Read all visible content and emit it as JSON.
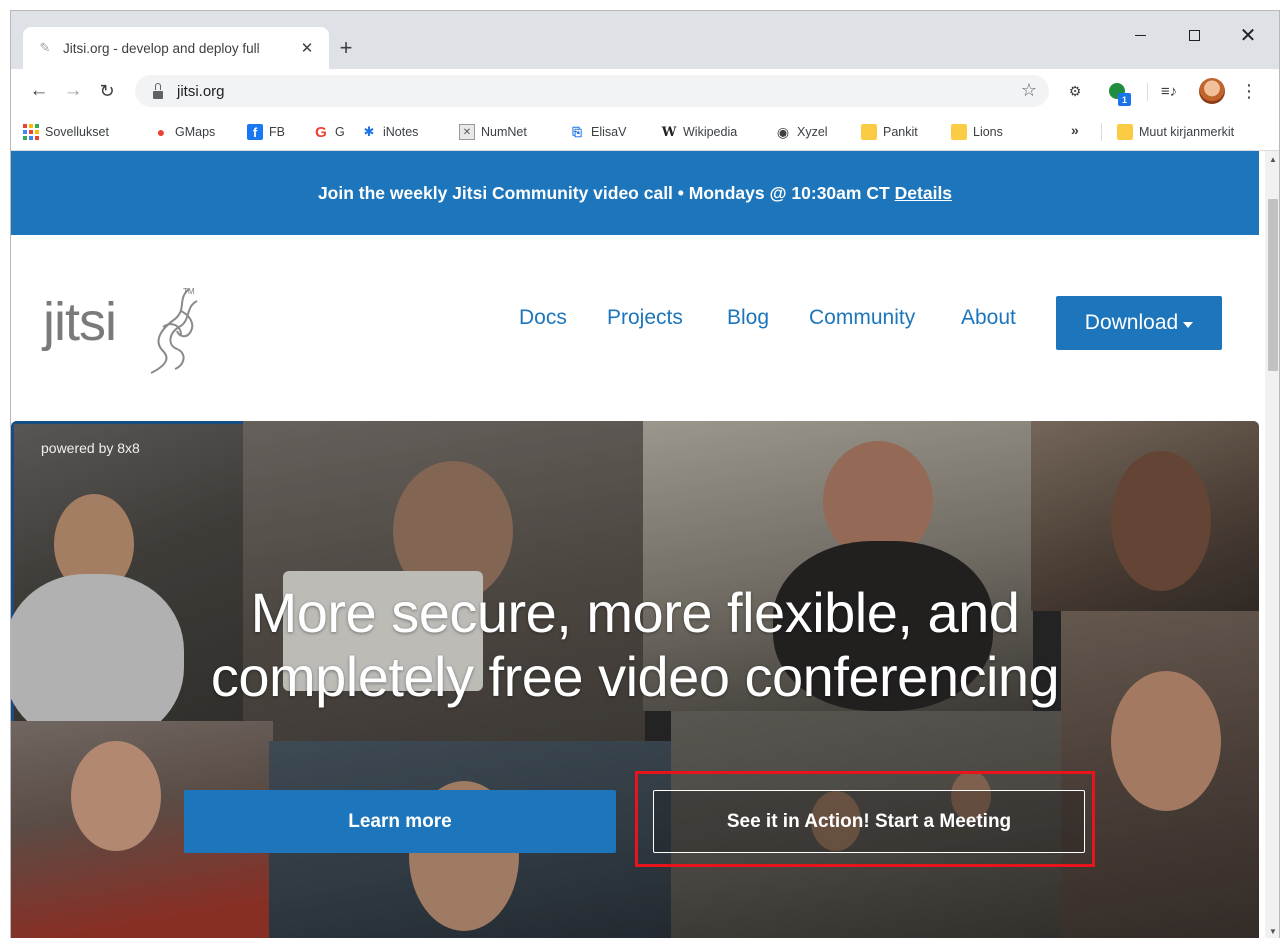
{
  "browser": {
    "tab_title": "Jitsi.org - develop and deploy full",
    "url": "jitsi.org",
    "extension_badge": "1",
    "bookmarks": [
      {
        "label": "Sovellukset",
        "icon": "apps-grid-icon"
      },
      {
        "label": "GMaps",
        "icon": "maps-pin-icon"
      },
      {
        "label": "FB",
        "icon": "facebook-icon"
      },
      {
        "label": "G",
        "icon": "google-icon"
      },
      {
        "label": "iNotes",
        "icon": "inotes-icon"
      },
      {
        "label": "NumNet",
        "icon": "numnet-icon"
      },
      {
        "label": "ElisaV",
        "icon": "elisa-icon"
      },
      {
        "label": "Wikipedia",
        "icon": "wikipedia-icon"
      },
      {
        "label": "Xyzel",
        "icon": "globe-icon"
      },
      {
        "label": "Pankit",
        "icon": "folder-icon"
      },
      {
        "label": "Lions",
        "icon": "folder-icon"
      }
    ],
    "bookmarks_overflow": "»",
    "other_bookmarks": "Muut kirjanmerkit"
  },
  "page": {
    "banner": {
      "text": "Join the weekly Jitsi Community video call • Mondays @ 10:30am CT",
      "link": "Details"
    },
    "logo": {
      "text": "jitsi",
      "tm": "TM"
    },
    "nav": {
      "docs": "Docs",
      "projects": "Projects",
      "blog": "Blog",
      "community": "Community",
      "about": "About",
      "download": "Download"
    },
    "hero": {
      "powered_by": "powered by 8x8",
      "title_line1": "More secure, more flexible, and",
      "title_line2": "completely free video conferencing",
      "learn_more": "Learn more",
      "start_meeting": "See it in Action! Start a Meeting"
    }
  },
  "colors": {
    "brand_blue": "#1d76bc",
    "highlight_red": "#e8141b"
  }
}
